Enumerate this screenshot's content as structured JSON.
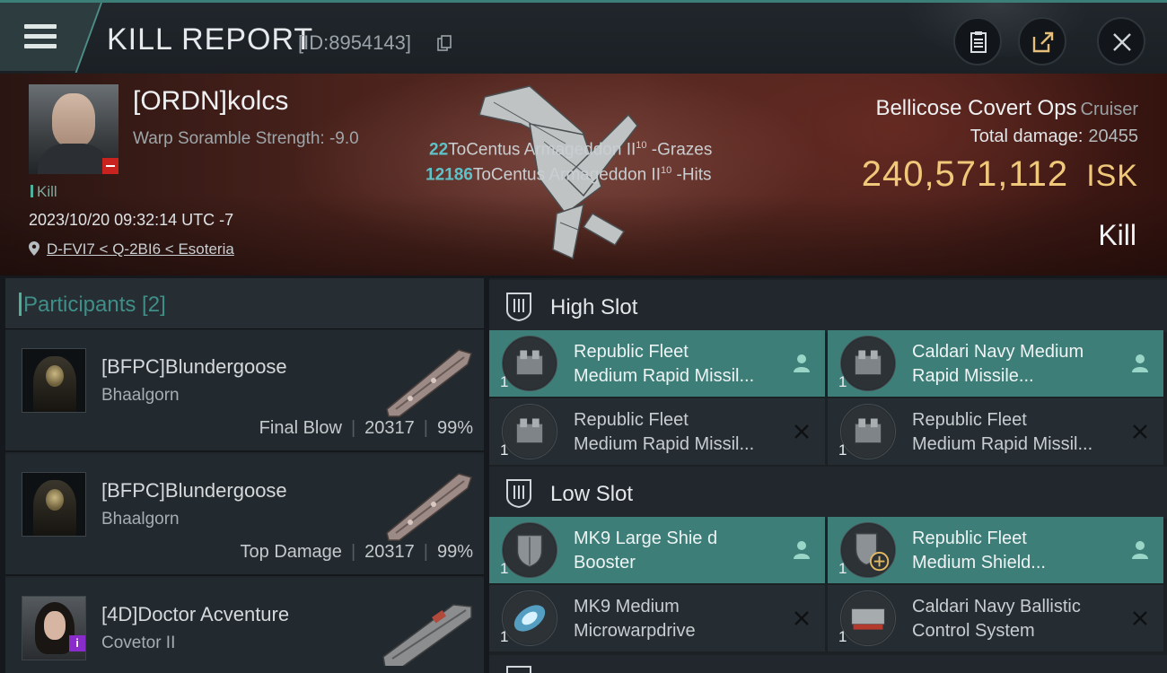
{
  "header": {
    "title": "KILL REPORT",
    "report_id": "[ID:8954143]"
  },
  "victim": {
    "name": "[ORDN]kolcs",
    "scramble": "Warp Soramble Strength: -9.0",
    "kill_tag": "Kill",
    "timestamp": "2023/10/20 09:32:14 UTC -7",
    "location": "D-FVI7 < Q-2BI6 < Esoteria"
  },
  "damage_log": [
    {
      "amount": "22",
      "text": "ToCentus Armageddon II",
      "level": "10",
      "result": " -Grazes"
    },
    {
      "amount": "12186",
      "text": "ToCentus Armageddon II",
      "level": "10",
      "result": " -Hits"
    }
  ],
  "ship": {
    "name": "Bellicose Covert Ops",
    "class": "Cruiser",
    "total_damage_label": "Total damage:",
    "total_damage": "20455",
    "isk_value": "240,571,112",
    "isk_unit": "ISK",
    "outcome": "Kill"
  },
  "participants": {
    "title": "Participants [2]",
    "rows": [
      {
        "name": "[BFPC]Blundergoose",
        "ship": "Bhaalgorn",
        "role": "Final Blow",
        "damage": "20317",
        "percent": "99%"
      },
      {
        "name": "[BFPC]Blundergoose",
        "ship": "Bhaalgorn",
        "role": "Top Damage",
        "damage": "20317",
        "percent": "99%"
      },
      {
        "name": "[4D]Doctor Acventure",
        "ship": "Covetor II"
      }
    ]
  },
  "fitting": {
    "high_slot": {
      "title": "High Slot",
      "modules": [
        {
          "qty": "1",
          "line1": "Republic Fleet",
          "line2": "Medium Rapid Missil...",
          "status": "dropped"
        },
        {
          "qty": "1",
          "line1": "Caldari Navy Medium",
          "line2": "Rapid Missile...",
          "status": "dropped"
        },
        {
          "qty": "1",
          "line1": "Republic Fleet",
          "line2": "Medium Rapid Missil...",
          "status": "destroyed"
        },
        {
          "qty": "1",
          "line1": "Republic Fleet",
          "line2": "Medium Rapid Missil...",
          "status": "destroyed"
        }
      ]
    },
    "low_slot": {
      "title": "Low Slot",
      "modules": [
        {
          "qty": "1",
          "line1": "MK9 Large Shie d",
          "line2": "Booster",
          "status": "dropped"
        },
        {
          "qty": "1",
          "line1": "Republic Fleet",
          "line2": "Medium Shield...",
          "status": "dropped"
        },
        {
          "qty": "1",
          "line1": "MK9 Medium",
          "line2": "Microwarpdrive",
          "status": "destroyed"
        },
        {
          "qty": "1",
          "line1": "Caldari Navy Ballistic",
          "line2": "Control System",
          "status": "destroyed"
        }
      ]
    }
  },
  "colors": {
    "accent_teal": "#3d7f78",
    "isk_gold": "#f0c87a",
    "damage_cyan": "#5ec3c9",
    "danger_red": "#c8231f"
  }
}
